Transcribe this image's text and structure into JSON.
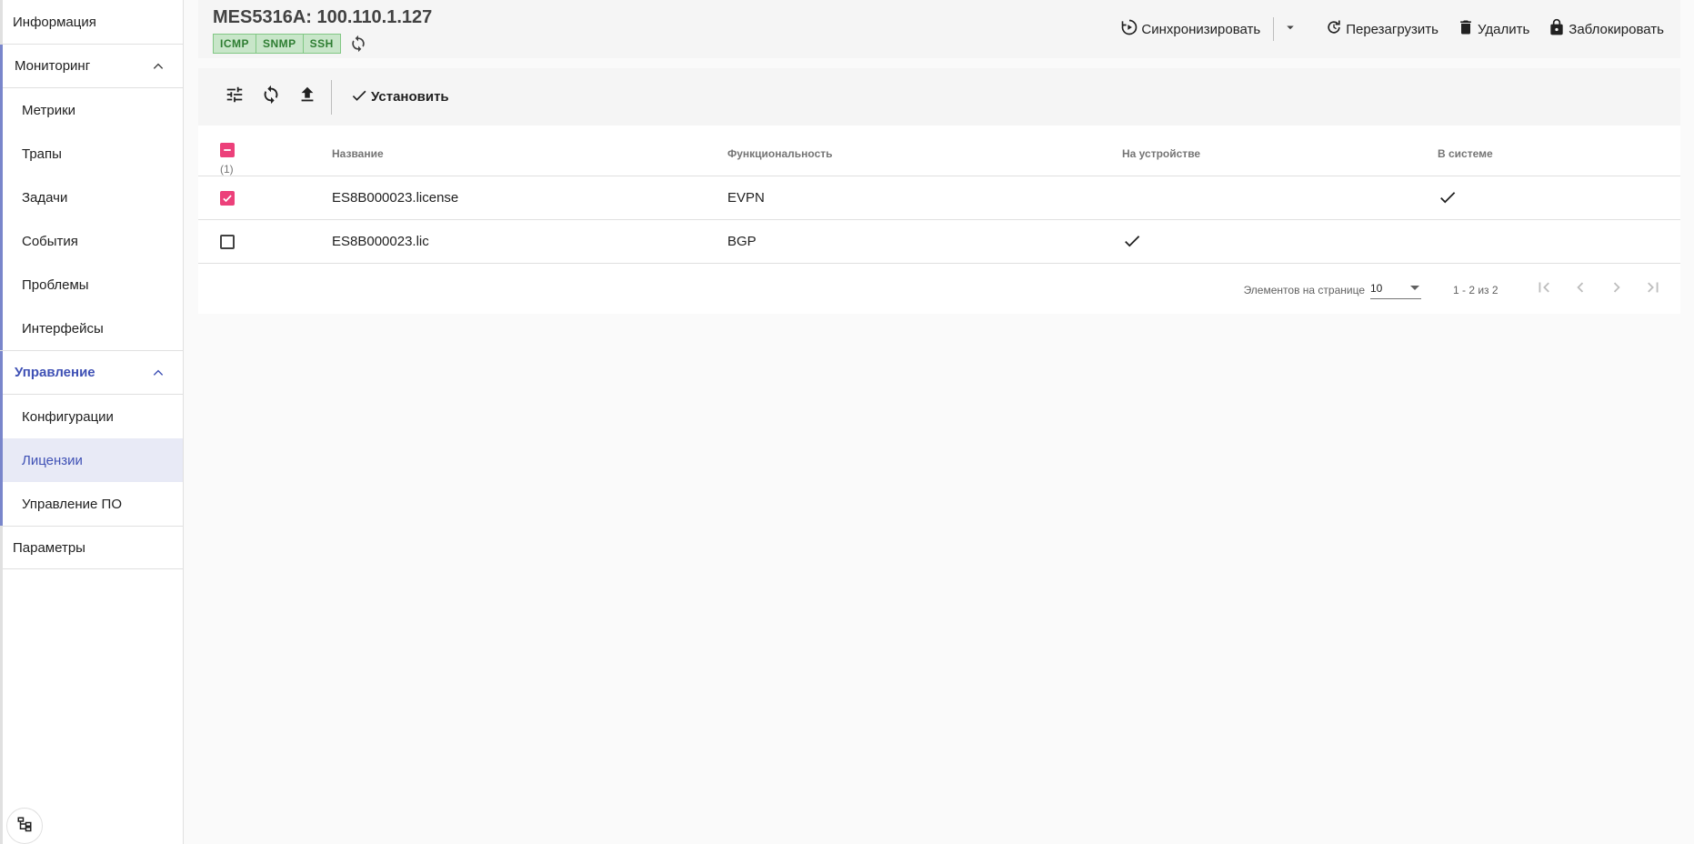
{
  "sidebar": {
    "info": "Информация",
    "monitoring": {
      "label": "Мониторинг",
      "items": [
        "Метрики",
        "Трапы",
        "Задачи",
        "События",
        "Проблемы",
        "Интерфейсы"
      ]
    },
    "management": {
      "label": "Управление",
      "items": [
        "Конфигурации",
        "Лицензии",
        "Управление ПО"
      ],
      "selected": "Лицензии"
    },
    "params": "Параметры"
  },
  "header": {
    "title": "MES5316A: 100.110.1.127",
    "protocols": [
      "ICMP",
      "SNMP",
      "SSH"
    ],
    "actions": {
      "sync": "Синхронизировать",
      "reboot": "Перезагрузить",
      "delete": "Удалить",
      "lock": "Заблокировать"
    }
  },
  "toolbar": {
    "install_label": "Установить"
  },
  "table": {
    "selected_count": "(1)",
    "columns": [
      "Название",
      "Функциональность",
      "На устройстве",
      "В системе"
    ],
    "rows": [
      {
        "checked": true,
        "name": "ES8B000023.license",
        "feature": "EVPN",
        "on_device": false,
        "in_system": true
      },
      {
        "checked": false,
        "name": "ES8B000023.lic",
        "feature": "BGP",
        "on_device": true,
        "in_system": false
      }
    ]
  },
  "paginator": {
    "items_per_page_label": "Элементов на странице",
    "page_size": "10",
    "range": "1 - 2 из 2"
  },
  "colors": {
    "accent": "#3f51b5",
    "checkbox": "#ec407a",
    "proto_bg": "#c8e6c9",
    "proto_text": "#2e7d32"
  }
}
